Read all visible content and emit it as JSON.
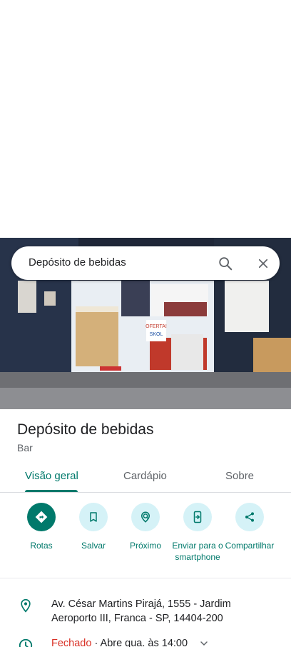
{
  "search": {
    "query": "Depósito de bebidas"
  },
  "place": {
    "name": "Depósito de bebidas",
    "category": "Bar"
  },
  "tabs": [
    {
      "label": "Visão geral",
      "active": true
    },
    {
      "label": "Cardápio",
      "active": false
    },
    {
      "label": "Sobre",
      "active": false
    }
  ],
  "actions": [
    {
      "label": "Rotas",
      "icon": "directions-icon"
    },
    {
      "label": "Salvar",
      "icon": "bookmark-icon"
    },
    {
      "label": "Próximo",
      "icon": "nearby-icon"
    },
    {
      "label": "Enviar para o smartphone",
      "icon": "send-to-phone-icon"
    },
    {
      "label": "Compartilhar",
      "icon": "share-icon"
    }
  ],
  "info": {
    "address": "Av. César Martins Pirajá, 1555 - Jardim Aeroporto III, Franca - SP, 14404-200",
    "hours_status": "Fechado",
    "hours_detail": " · Abre qua. às 14:00"
  },
  "photo_sign_text": "OFERTA! SKOL",
  "colors": {
    "accent": "#00796b",
    "action_bg": "#d5f2f7",
    "closed": "#d93025",
    "text_secondary": "#5f6368"
  }
}
